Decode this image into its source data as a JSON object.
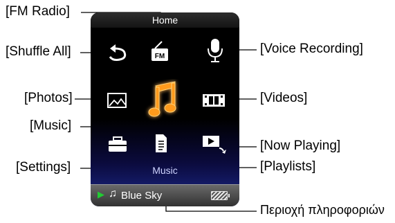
{
  "screen": {
    "title": "Home",
    "bottom_caption": "Music",
    "info_bar": {
      "play_icon": "play-icon",
      "note_icon": "music-note-icon",
      "song": "Blue Sky",
      "battery_icon": "battery-icon"
    },
    "icons": {
      "shuffle_all": "shuffle-all-icon",
      "fm_radio": "fm-radio-icon",
      "voice_recording": "microphone-icon",
      "photos": "photo-icon",
      "music": "music-note-icon",
      "videos": "film-icon",
      "settings": "toolbox-icon",
      "playlists": "document-icon",
      "now_playing": "now-playing-icon"
    },
    "colors": {
      "music_glow": "#ff9a1f",
      "play_green": "#22cc33",
      "screen_bottom": "#1d2a8e"
    }
  },
  "labels": {
    "fm_radio": "[FM Radio]",
    "shuffle_all": "[Shuffle All]",
    "photos": "[Photos]",
    "music": "[Music]",
    "settings": "[Settings]",
    "voice_recording": "[Voice Recording]",
    "videos": "[Videos]",
    "now_playing": "[Now Playing]",
    "playlists": "[Playlists]",
    "info_area": "Περιοχή πληροφοριών"
  }
}
